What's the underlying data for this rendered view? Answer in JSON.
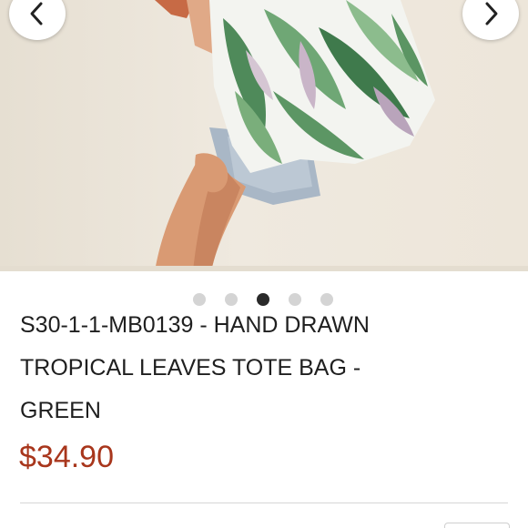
{
  "product": {
    "title_line1": "S30-1-1-MB0139 - HAND DRAWN",
    "title_line2": "TROPICAL LEAVES TOTE BAG -",
    "title_line3": "GREEN",
    "price": "$34.90"
  },
  "gallery": {
    "slide_count": 5,
    "active_index": 2,
    "prev_icon": "chevron-left-icon",
    "next_icon": "chevron-right-icon"
  },
  "colors": {
    "price": "#a8361c",
    "active_dot": "#2a2a2a",
    "inactive_dot": "#d4d4d4"
  }
}
